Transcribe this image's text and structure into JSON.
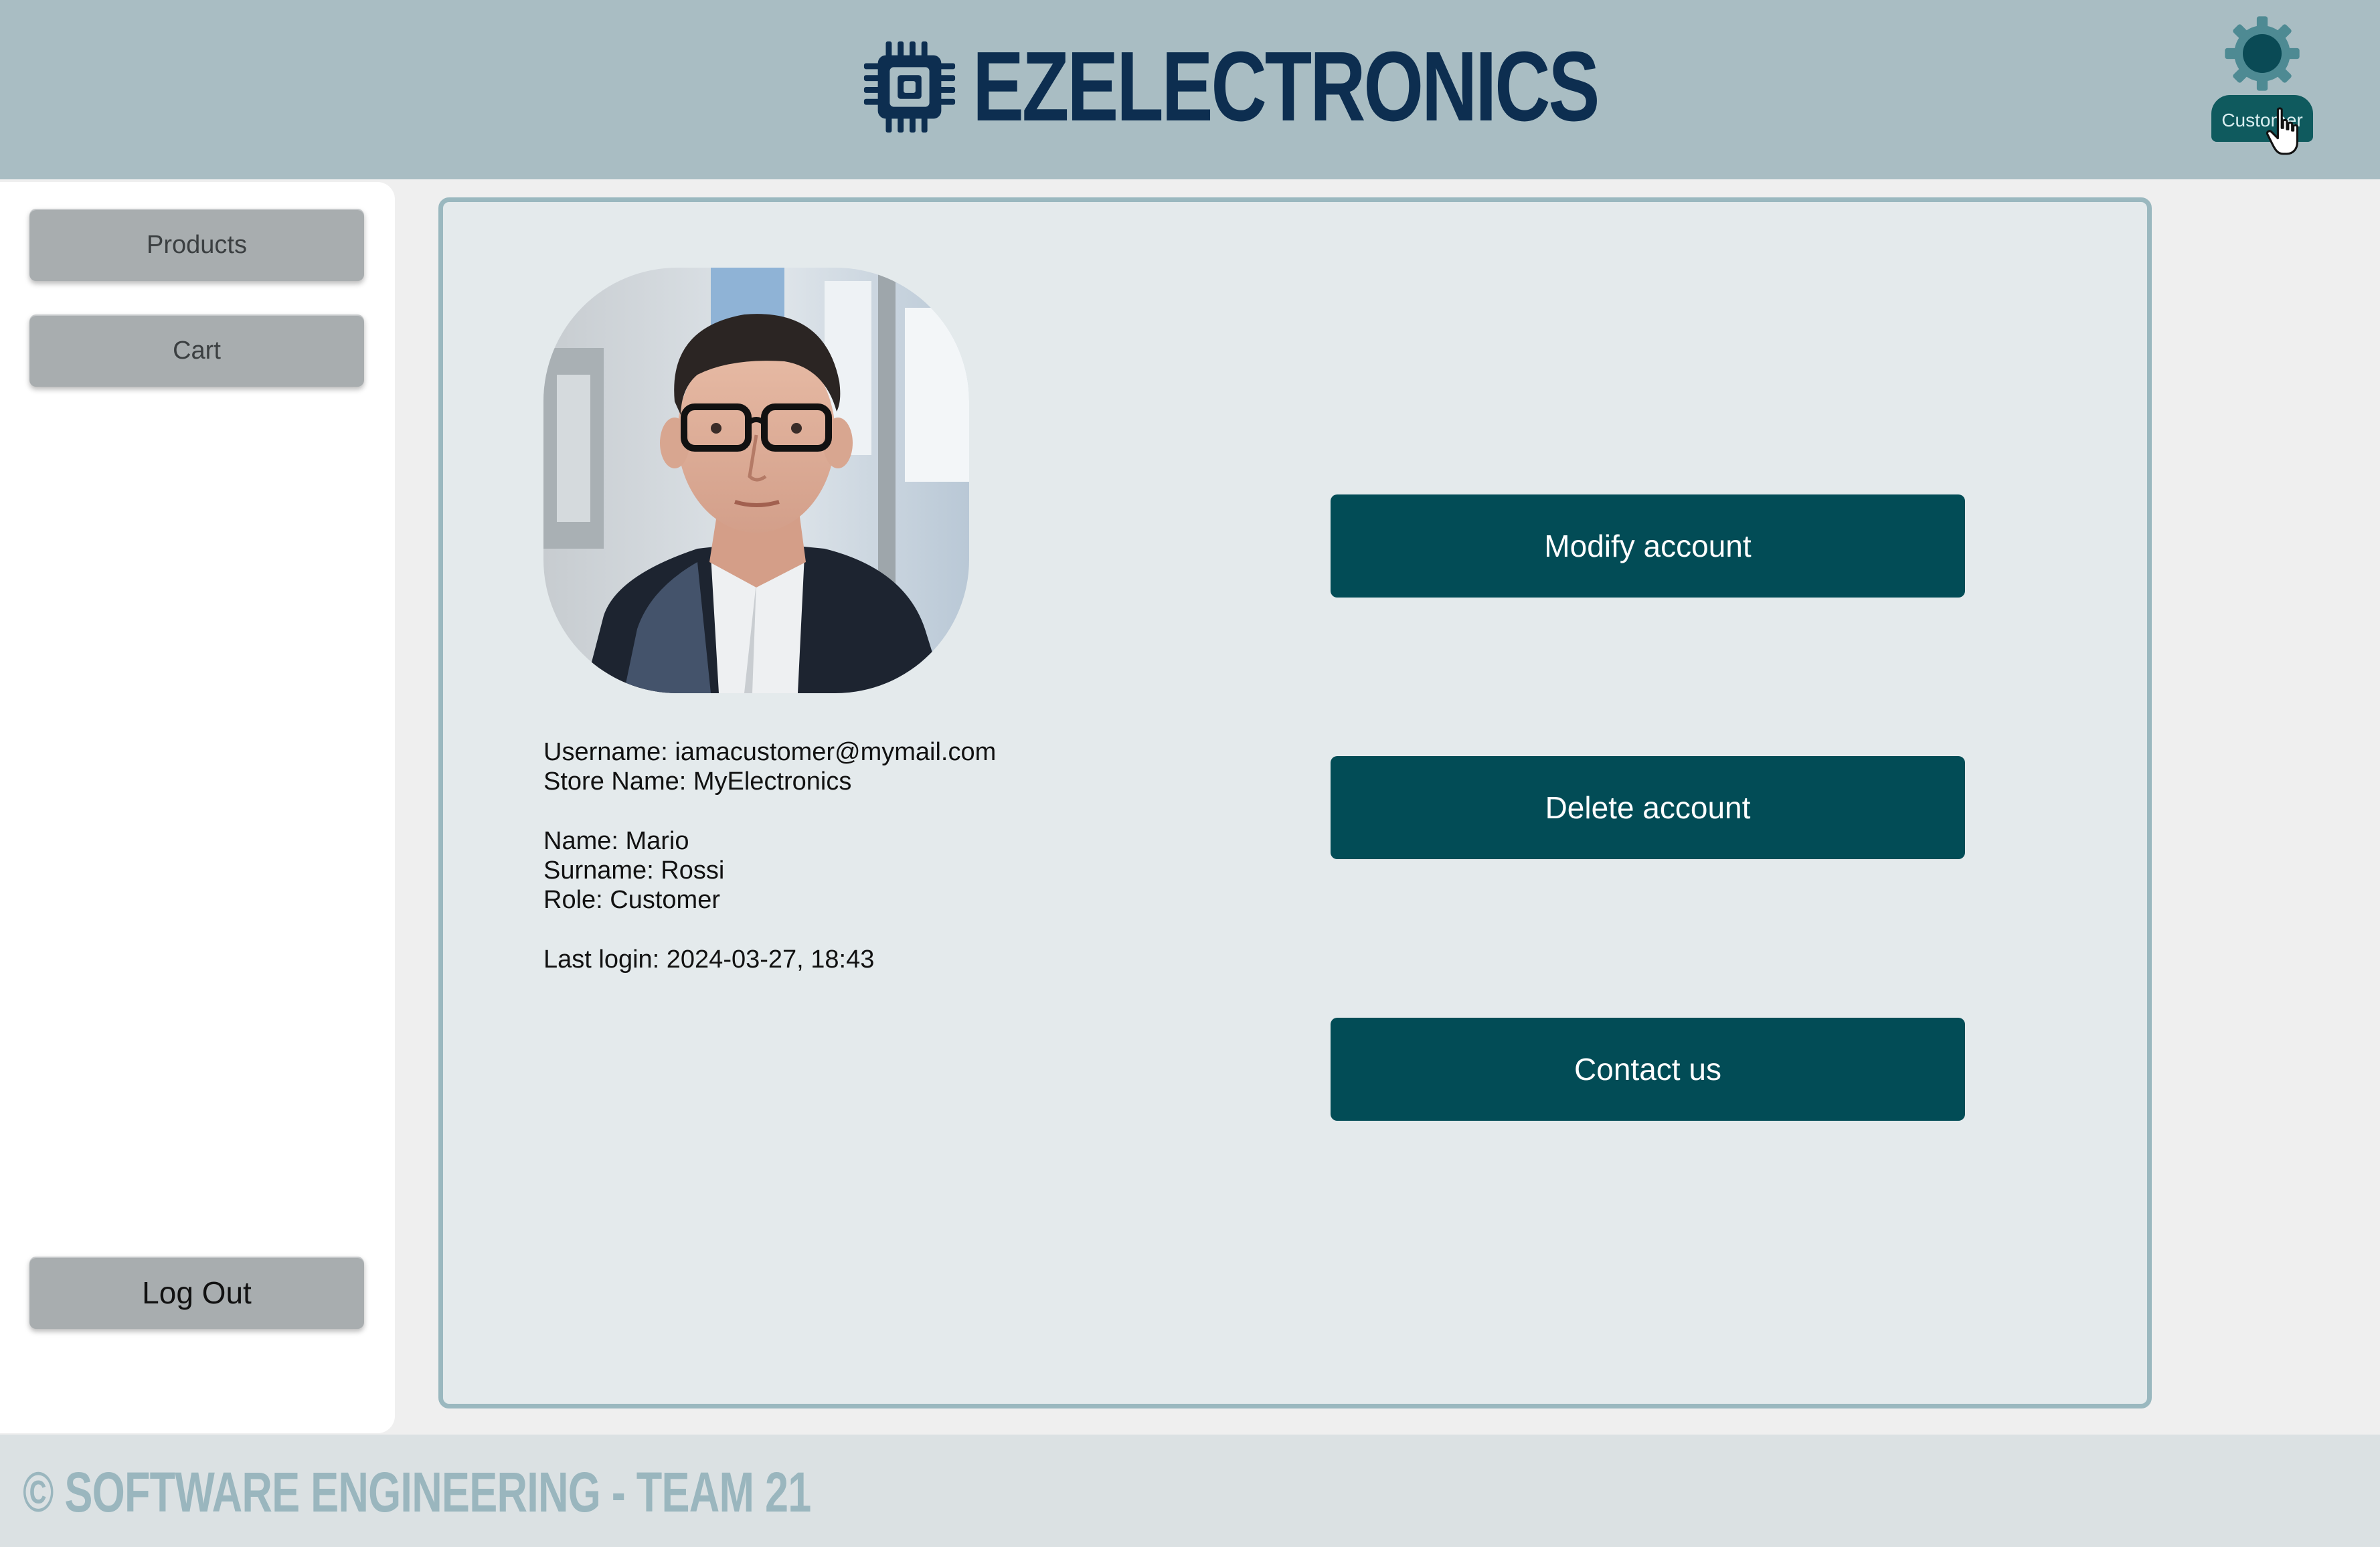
{
  "header": {
    "brand_name": "EZELECTRONICS",
    "logo_icon": "chip-icon",
    "user_menu": {
      "icon": "gear-icon",
      "role_label": "Customer"
    }
  },
  "sidebar": {
    "items": [
      {
        "label": "Products"
      },
      {
        "label": "Cart"
      }
    ],
    "logout_label": "Log Out"
  },
  "profile": {
    "username_line": "Username: iamacustomer@mymail.com",
    "store_line": "Store Name: MyElectronics",
    "name_line": "Name: Mario",
    "surname_line": "Surname: Rossi",
    "role_line": "Role: Customer",
    "last_login_line": "Last login: 2024-03-27, 18:43"
  },
  "actions": {
    "modify_label": "Modify account",
    "delete_label": "Delete account",
    "contact_label": "Contact us"
  },
  "footer": {
    "text": "© SOFTWARE ENGINEERING - TEAM 21"
  },
  "colors": {
    "header_bg": "#a9bdc3",
    "brand": "#0d2e50",
    "accent": "#024c56",
    "panel_bg": "#e4eaec",
    "panel_border": "#9ab8bf",
    "sidebar_button": "#a8adaf"
  }
}
